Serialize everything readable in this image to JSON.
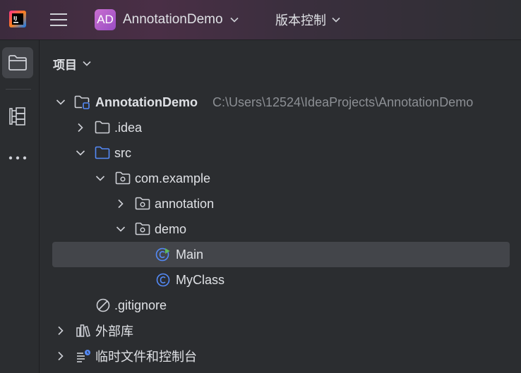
{
  "titlebar": {
    "project_badge": "AD",
    "project_name": "AnnotationDemo",
    "vcs_label": "版本控制"
  },
  "toolstrip": {
    "items": [
      "folder-icon",
      "structure-icon",
      "more-icon"
    ]
  },
  "panel": {
    "title": "项目"
  },
  "tree": {
    "root": {
      "label": "AnnotationDemo",
      "path": "C:\\Users\\12524\\IdeaProjects\\AnnotationDemo"
    },
    "idea": {
      "label": ".idea"
    },
    "src": {
      "label": "src"
    },
    "com_example": {
      "label": "com.example"
    },
    "annotation": {
      "label": "annotation"
    },
    "demo": {
      "label": "demo"
    },
    "main": {
      "label": "Main"
    },
    "myclass": {
      "label": "MyClass"
    },
    "gitignore": {
      "label": ".gitignore"
    },
    "external_libs": {
      "label": "外部库"
    },
    "scratches": {
      "label": "临时文件和控制台"
    }
  },
  "colors": {
    "background": "#2b2d30",
    "selection": "#43454a",
    "accent_blue": "#548af7",
    "class_green": "#5fb85c",
    "badge_purple": "#b45ccb",
    "path_gray": "#8c8f94"
  }
}
